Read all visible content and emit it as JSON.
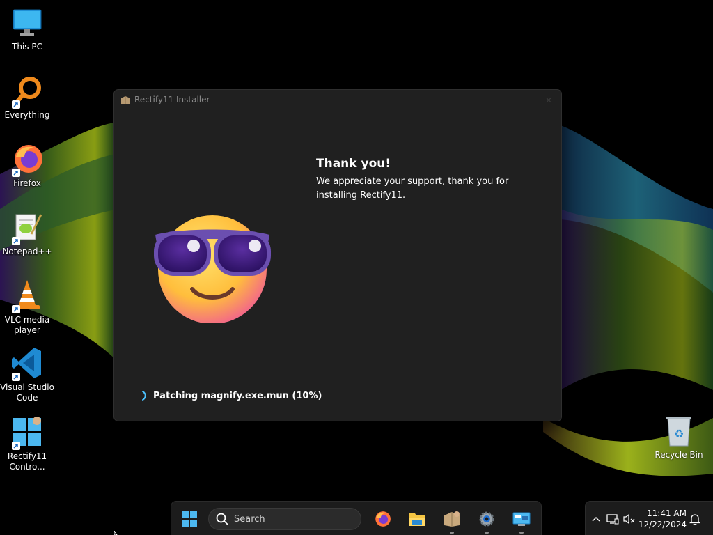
{
  "desktop": {
    "icons": [
      {
        "label": "This PC",
        "icon": "monitor-icon"
      },
      {
        "label": "Everything",
        "icon": "search-magnifier-icon"
      },
      {
        "label": "Firefox",
        "icon": "firefox-icon"
      },
      {
        "label": "Notepad++",
        "icon": "notepad-plus-plus-icon"
      },
      {
        "label": "VLC media\nplayer",
        "icon": "vlc-cone-icon"
      },
      {
        "label": "Visual Studio\nCode",
        "icon": "vscode-icon"
      },
      {
        "label": "Rectify11\nContro...",
        "icon": "rectify11-control-icon"
      }
    ],
    "recycle_bin": {
      "label": "Recycle Bin",
      "icon": "recycle-bin-icon"
    }
  },
  "installer": {
    "title": "Rectify11 Installer",
    "heading": "Thank you!",
    "message": "We appreciate your support, thank you for installing Rectify11.",
    "status": "Patching magnify.exe.mun (10%)",
    "progress_percent": 10
  },
  "taskbar": {
    "search_placeholder": "Search",
    "pinned": [
      "start-icon",
      "firefox-icon",
      "file-explorer-icon",
      "rectify11-installer-icon",
      "settings-icon",
      "control-panel-icon"
    ]
  },
  "tray": {
    "time": "11:41 AM",
    "date": "12/22/2024"
  },
  "colors": {
    "window_bg": "#202020",
    "taskbar_bg": "#1c1c1c",
    "accent": "#4cc2ff"
  }
}
